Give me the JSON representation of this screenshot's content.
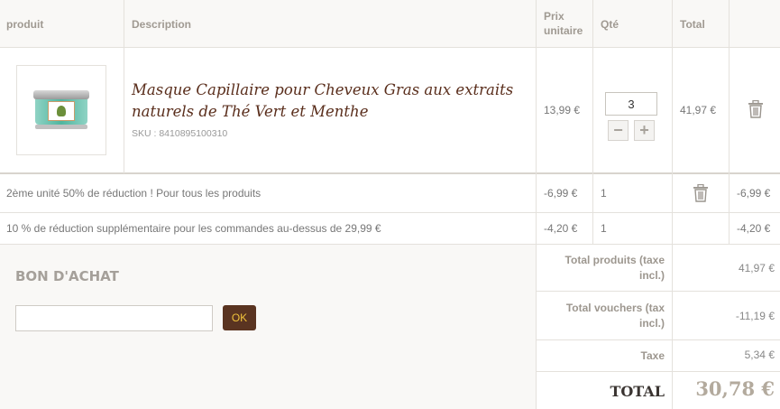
{
  "header": {
    "product": "produit",
    "description": "Description",
    "unit_price_line1": "Prix",
    "unit_price_line2": "unitaire",
    "qty": "Qté",
    "total": "Total"
  },
  "item": {
    "name_line1": "Masque Capillaire pour Cheveux Gras aux extraits",
    "name_line2": "naturels de Thé Vert et Menthe",
    "sku": "SKU : 8410895100310",
    "unit_price": "13,99 €",
    "qty": "3",
    "total": "41,97 €",
    "image_icon": "product-jar-image"
  },
  "discounts": [
    {
      "label": "2ème unité 50% de réduction ! Pour tous les produits",
      "price": "-6,99 €",
      "qty": "1",
      "total": "-6,99 €"
    },
    {
      "label": "10 % de réduction supplémentaire pour les commandes au-dessus de 29,99 €",
      "price": "-4,20 €",
      "qty": "1",
      "total": "-4,20 €"
    }
  ],
  "voucher": {
    "title": "BON D'ACHAT",
    "input_value": "",
    "ok_label": "OK"
  },
  "summary": {
    "products_label_line1": "Total produits (taxe",
    "products_label_line2": "incl.)",
    "products_value": "41,97 €",
    "vouchers_label_line1": "Total vouchers (tax",
    "vouchers_label_line2": "incl.)",
    "vouchers_value": "-11,19 €",
    "tax_label": "Taxe",
    "tax_value": "5,34 €",
    "total_label": "TOTAL",
    "total_value": "30,78 €"
  },
  "colors": {
    "title_brown": "#5a2e1c",
    "ok_bg": "#5a3421",
    "ok_text": "#f0c23b"
  }
}
